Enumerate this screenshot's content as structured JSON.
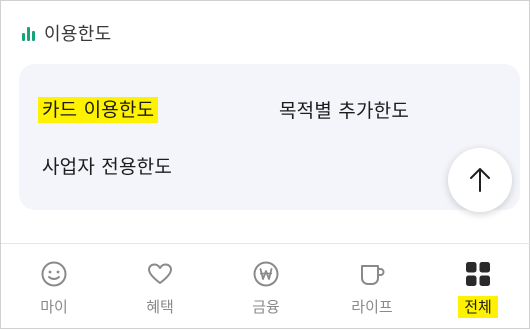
{
  "section": {
    "title": "이용한도",
    "icon": "bar-chart-icon",
    "accent_color": "#1aa37b"
  },
  "panel": {
    "links": [
      {
        "label": "카드 이용한도",
        "highlighted": true
      },
      {
        "label": "목적별 추가한도",
        "highlighted": false
      },
      {
        "label": "사업자 전용한도",
        "highlighted": false
      }
    ],
    "background": "#f3f5fa"
  },
  "scroll_top": {
    "icon": "arrow-up-icon"
  },
  "tabbar": {
    "tabs": [
      {
        "label": "마이",
        "icon": "smile-icon",
        "active": false
      },
      {
        "label": "혜택",
        "icon": "heart-icon",
        "active": false
      },
      {
        "label": "금융",
        "icon": "won-coin-icon",
        "active": false
      },
      {
        "label": "라이프",
        "icon": "cup-icon",
        "active": false
      },
      {
        "label": "전체",
        "icon": "grid-icon",
        "active": true
      }
    ],
    "highlight_color": "#fff200"
  }
}
